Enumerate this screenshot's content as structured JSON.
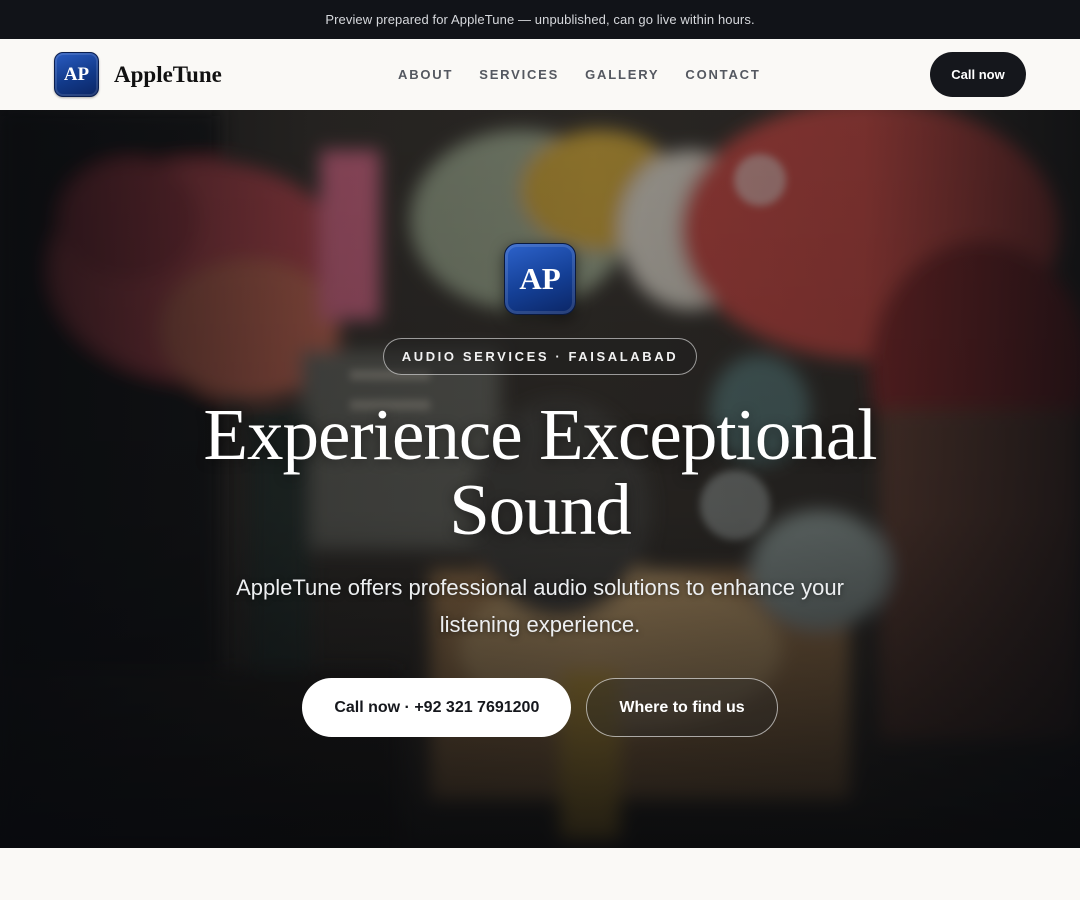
{
  "preview_banner": "Preview prepared for AppleTune — unpublished, can go live within hours.",
  "brand": {
    "logo_text": "AP",
    "name": "AppleTune",
    "accent": "#1a4aa8"
  },
  "nav": {
    "links": [
      "ABOUT",
      "SERVICES",
      "GALLERY",
      "CONTACT"
    ],
    "cta_label": "Call now"
  },
  "hero": {
    "logo_text": "AP",
    "badge": "AUDIO SERVICES · FAISALABAD",
    "title": "Experience Exceptional Sound",
    "subtitle": "AppleTune offers professional audio solutions to enhance your listening experience.",
    "primary_cta": "Call now · +92 321 7691200",
    "secondary_cta": "Where to find us",
    "background_image": "market-stall-photo"
  },
  "colors": {
    "dark": "#15171c",
    "page": "#faf9f6",
    "banner_bg": "#111318"
  }
}
